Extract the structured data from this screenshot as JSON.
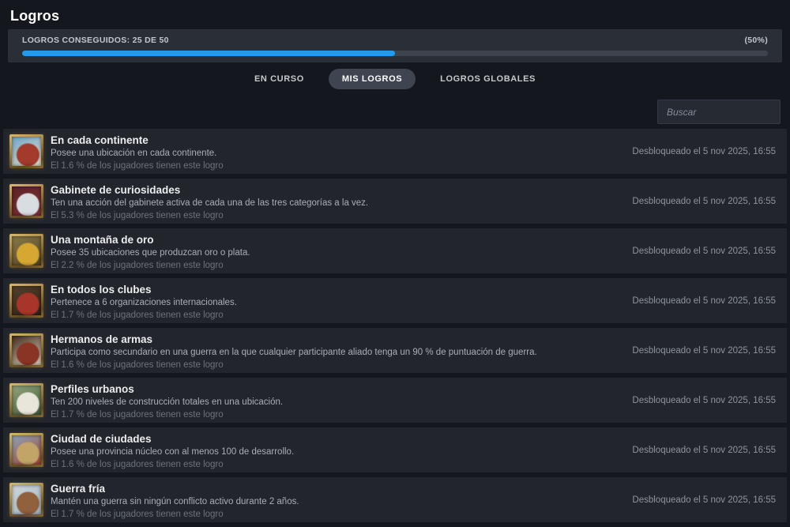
{
  "window": {
    "title": "Logros"
  },
  "progress": {
    "label": "LOGROS CONSEGUIDOS: 25 DE 50",
    "percent_label": "(50%)",
    "percent": 50,
    "fill_color": "#1f9cf0",
    "track_color": "#3e444e"
  },
  "tabs": [
    {
      "id": "en-curso",
      "label": "EN CURSO",
      "active": false
    },
    {
      "id": "mis-logros",
      "label": "MIS LOGROS",
      "active": true
    },
    {
      "id": "logros-globales",
      "label": "LOGROS GLOBALES",
      "active": false
    }
  ],
  "search": {
    "placeholder": "Buscar"
  },
  "achievements": [
    {
      "title": "En cada continente",
      "description": "Posee una ubicación en cada continente.",
      "rarity": "El 1.6 % de los jugadores tienen este logro",
      "unlocked": "Desbloqueado el 5 nov 2025, 16:55",
      "icon": {
        "name": "explorer-ship-icon",
        "c1": "#6fa7cc",
        "c2": "#a33a2c",
        "c3": "#e3dcc8"
      }
    },
    {
      "title": "Gabinete de curiosidades",
      "description": "Ten una acción del gabinete activa de cada una de las tres categorías a la vez.",
      "rarity": "El 5.3 % de los jugadores tienen este logro",
      "unlocked": "Desbloqueado el 5 nov 2025, 16:55",
      "icon": {
        "name": "cabinet-dove-icon",
        "c1": "#5c2328",
        "c2": "#d8dde2",
        "c3": "#7e3036"
      }
    },
    {
      "title": "Una montaña de oro",
      "description": "Posee 35 ubicaciones que produzcan oro o plata.",
      "rarity": "El 2.2 % de los jugadores tienen este logro",
      "unlocked": "Desbloqueado el 5 nov 2025, 16:55",
      "icon": {
        "name": "gold-pile-icon",
        "c1": "#8a7a48",
        "c2": "#d6a832",
        "c3": "#4e4226"
      }
    },
    {
      "title": "En todos los clubes",
      "description": "Pertenece a 6 organizaciones internacionales.",
      "rarity": "El 1.7 % de los jugadores tienen este logro",
      "unlocked": "Desbloqueado el 5 nov 2025, 16:55",
      "icon": {
        "name": "red-cap-figure-icon",
        "c1": "#54402c",
        "c2": "#a8352a",
        "c3": "#2e2218"
      }
    },
    {
      "title": "Hermanos de armas",
      "description": "Participa como secundario en una guerra en la que cualquier participante aliado tenga un 90 % de puntuación de guerra.",
      "rarity": "El 1.6 % de los jugadores tienen este logro",
      "unlocked": "Desbloqueado el 5 nov 2025, 16:55",
      "icon": {
        "name": "clasped-arms-icon",
        "c1": "#432c20",
        "c2": "#8a3424",
        "c3": "#d9cfb8"
      }
    },
    {
      "title": "Perfiles urbanos",
      "description": "Ten 200 niveles de construcción totales en una ubicación.",
      "rarity": "El 1.7 % de los jugadores tienen este logro",
      "unlocked": "Desbloqueado el 5 nov 2025, 16:55",
      "icon": {
        "name": "green-emblem-icon",
        "c1": "#93a57c",
        "c2": "#e8e6da",
        "c3": "#41583a"
      }
    },
    {
      "title": "Ciudad de ciudades",
      "description": "Posee una provincia núcleo con al menos 100 de desarrollo.",
      "rarity": "El 1.6 % de los jugadores tienen este logro",
      "unlocked": "Desbloqueado el 5 nov 2025, 16:55",
      "icon": {
        "name": "city-scene-icon",
        "c1": "#8ea4ba",
        "c2": "#c3a468",
        "c3": "#9c4532"
      }
    },
    {
      "title": "Guerra fría",
      "description": "Mantén una guerra sin ningún conflicto activo durante 2 años.",
      "rarity": "El 1.7 % de los jugadores tienen este logro",
      "unlocked": "Desbloqueado el 5 nov 2025, 16:55",
      "icon": {
        "name": "winter-bird-icon",
        "c1": "#cfd7dc",
        "c2": "#91603c",
        "c3": "#9fb4c0"
      }
    }
  ]
}
